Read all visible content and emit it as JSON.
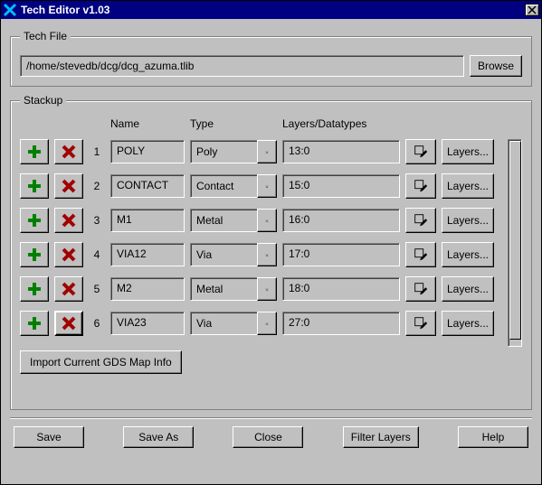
{
  "window": {
    "title": "Tech Editor v1.03"
  },
  "panels": {
    "techfile": "Tech File",
    "stackup": "Stackup"
  },
  "techfile": {
    "path": "/home/stevedb/dcg/dcg_azuma.tlib",
    "browse": "Browse"
  },
  "stackup": {
    "headers": {
      "name": "Name",
      "type": "Type",
      "ldt": "Layers/Datatypes"
    },
    "rows": [
      {
        "idx": "1",
        "name": "POLY",
        "type": "Poly",
        "ldt": "13:0"
      },
      {
        "idx": "2",
        "name": "CONTACT",
        "type": "Contact",
        "ldt": "15:0"
      },
      {
        "idx": "3",
        "name": "M1",
        "type": "Metal",
        "ldt": "16:0"
      },
      {
        "idx": "4",
        "name": "VIA12",
        "type": "Via",
        "ldt": "17:0"
      },
      {
        "idx": "5",
        "name": "M2",
        "type": "Metal",
        "ldt": "18:0"
      },
      {
        "idx": "6",
        "name": "VIA23",
        "type": "Via",
        "ldt": "27:0"
      }
    ],
    "layers_btn": "Layers...",
    "import": "Import Current GDS Map Info"
  },
  "buttons": {
    "save": "Save",
    "saveas": "Save As",
    "close": "Close",
    "filter": "Filter Layers",
    "help": "Help"
  }
}
